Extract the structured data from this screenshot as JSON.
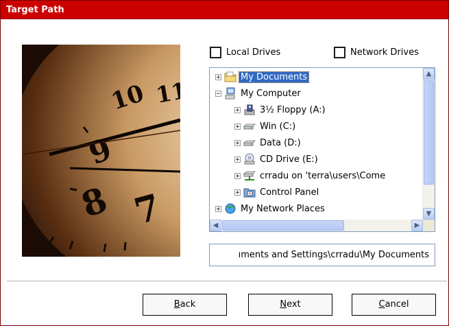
{
  "window": {
    "title": "Target Path"
  },
  "checkboxes": {
    "local": {
      "label": "Local Drives",
      "checked": false
    },
    "network": {
      "label": "Network Drives",
      "checked": false
    }
  },
  "tree": {
    "items": [
      {
        "label": "My Documents",
        "expander": "+",
        "icon": "folder-documents-icon",
        "selected": true
      },
      {
        "label": "My Computer",
        "expander": "−",
        "icon": "computer-icon",
        "selected": false
      },
      {
        "label": "3½ Floppy (A:)",
        "expander": "+",
        "icon": "floppy-drive-icon",
        "selected": false
      },
      {
        "label": "Win (C:)",
        "expander": "+",
        "icon": "hard-drive-icon",
        "selected": false
      },
      {
        "label": "Data (D:)",
        "expander": "+",
        "icon": "hard-drive-icon",
        "selected": false
      },
      {
        "label": "CD Drive (E:)",
        "expander": "+",
        "icon": "cd-drive-icon",
        "selected": false
      },
      {
        "label": "crradu on 'terra\\users\\Come",
        "expander": "+",
        "icon": "network-drive-icon",
        "selected": false
      },
      {
        "label": "Control Panel",
        "expander": "+",
        "icon": "control-panel-icon",
        "selected": false
      },
      {
        "label": "My Network Places",
        "expander": "+",
        "icon": "network-places-icon",
        "selected": false
      }
    ]
  },
  "path_field": {
    "value": "ıments and Settings\\crradu\\My Documents"
  },
  "buttons": {
    "back": {
      "pre": "",
      "accel": "B",
      "post": "ack"
    },
    "next": {
      "pre": "",
      "accel": "N",
      "post": "ext"
    },
    "cancel": {
      "pre": "",
      "accel": "C",
      "post": "ancel"
    }
  },
  "colors": {
    "title_bar": "#cc0000",
    "selection": "#316ac5"
  }
}
